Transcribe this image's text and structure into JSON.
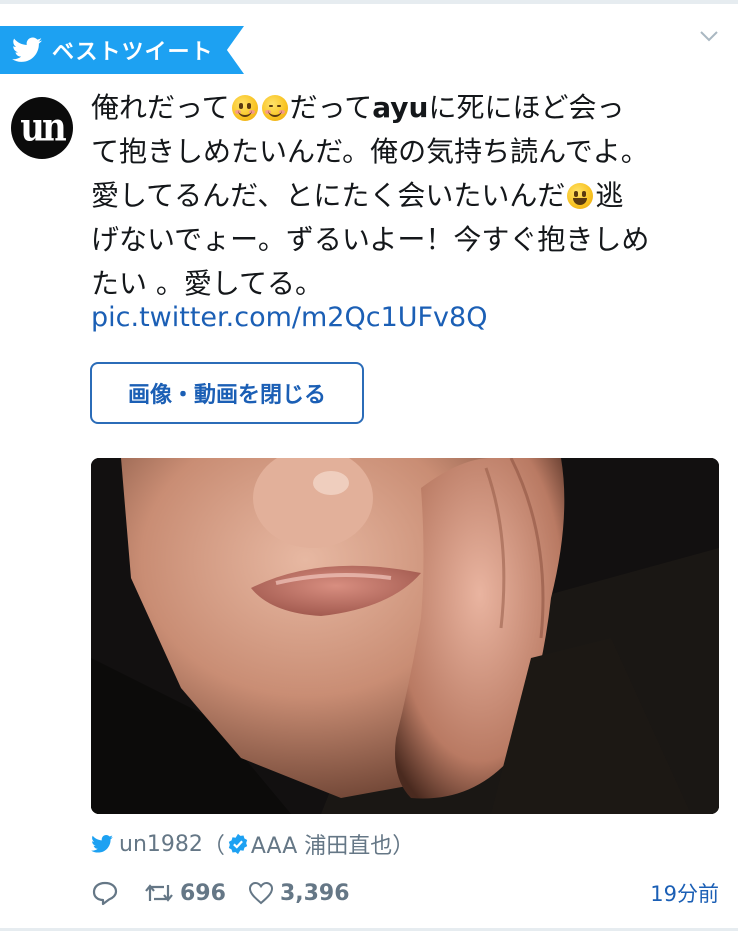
{
  "ribbon": {
    "label": "ベストツイート",
    "bird_icon": "twitter-bird-icon"
  },
  "header": {
    "menu_icon": "chevron-down-icon"
  },
  "user": {
    "avatar_text": "un",
    "screen_name": "un1982",
    "display_name": "AAA 浦田直也",
    "paren_open": "（",
    "paren_close": "）"
  },
  "tweet": {
    "line1": {
      "a": "俺れだって",
      "b": "だって",
      "c": "ayu",
      "d": "に死にほど会っ"
    },
    "line2": "て抱きしめたいんだ。俺の気持ち読んでよ。",
    "line3": {
      "a": "愛してるんだ、とにたく会いたいんだ",
      "b": "逃"
    },
    "line4": "げないでょー。ずるいよー！今すぐ抱きしめ",
    "line5": "たい 。愛してる。",
    "link": "pic.twitter.com/m2Qc1UFv8Q"
  },
  "emojis": [
    "smiling-face-icon",
    "relaxed-face-icon",
    "grinning-face-icon"
  ],
  "buttons": {
    "close_media": "画像・動画を閉じる"
  },
  "stats": {
    "retweets": "696",
    "likes": "3,396",
    "time": "19分前"
  },
  "colors": {
    "accent": "#1da1f2",
    "link": "#1b5fb5",
    "muted": "#657786"
  }
}
